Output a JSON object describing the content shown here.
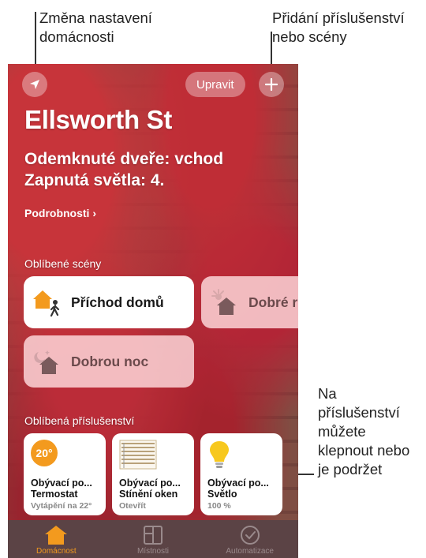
{
  "callouts": {
    "home_settings": "Změna nastavení\ndomácnosti",
    "add_accessory": "Přidání příslušenství\nnebo scény",
    "tap_hold": "Na\npříslušenství\nmůžete\nklepnout nebo\nje podržet"
  },
  "header": {
    "edit_label": "Upravit"
  },
  "home": {
    "title": "Ellsworth St",
    "status_line1": "Odemknuté dveře: vchod",
    "status_line2": "Zapnutá světla: 4.",
    "details": "Podrobnosti ›"
  },
  "favorite_scenes": {
    "heading": "Oblíbené scény",
    "items": [
      {
        "label": "Příchod domů",
        "icon": "arrive-home-icon"
      },
      {
        "label": "Dobré r",
        "icon": "good-morning-icon"
      },
      {
        "label": "Dobrou noc",
        "icon": "good-night-icon"
      }
    ]
  },
  "favorite_accessories": {
    "heading": "Oblíbená příslušenství",
    "items": [
      {
        "room": "Obývací po...",
        "name": "Termostat",
        "status": "Vytápění na 22°",
        "badge": "20°",
        "icon": "thermostat-icon"
      },
      {
        "room": "Obývací po...",
        "name": "Stínění oken",
        "status": "Otevřít",
        "icon": "window-blinds-icon"
      },
      {
        "room": "Obývací po...",
        "name": "Světlo",
        "status": "100 %",
        "icon": "lightbulb-icon"
      }
    ]
  },
  "tabs": [
    {
      "label": "Domácnost",
      "icon": "house-icon",
      "active": true
    },
    {
      "label": "Místnosti",
      "icon": "rooms-icon",
      "active": false
    },
    {
      "label": "Automatizace",
      "icon": "automation-icon",
      "active": false
    }
  ],
  "colors": {
    "accent": "#f39a1e",
    "scene_off": "#f6d6d8",
    "tab_inactive": "#9a8a8c"
  }
}
